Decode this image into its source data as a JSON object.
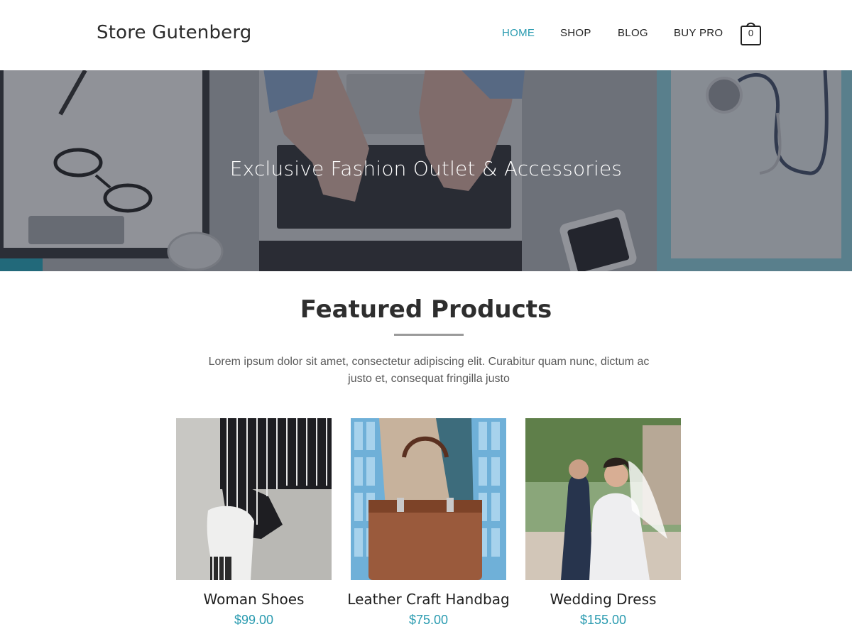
{
  "site": {
    "title": "Store Gutenberg"
  },
  "nav": {
    "items": [
      {
        "label": "HOME",
        "active": true
      },
      {
        "label": "SHOP",
        "active": false
      },
      {
        "label": "BLOG",
        "active": false
      },
      {
        "label": "BUY PRO",
        "active": false
      }
    ],
    "cart_count": "0",
    "cart_icon": "shopping-bag-icon"
  },
  "hero": {
    "title": "Exclusive Fashion Outlet & Accessories"
  },
  "featured": {
    "title": "Featured Products",
    "description": "Lorem ipsum dolor sit amet, consectetur adipiscing elit. Curabitur quam nunc, dictum ac justo et, consequat fringilla justo"
  },
  "products": [
    {
      "name": "Woman Shoes",
      "price": "$99.00"
    },
    {
      "name": "Leather Craft Handbag",
      "price": "$75.00"
    },
    {
      "name": "Wedding Dress",
      "price": "$155.00"
    }
  ],
  "colors": {
    "accent": "#2a9bb0",
    "text": "#333333"
  }
}
